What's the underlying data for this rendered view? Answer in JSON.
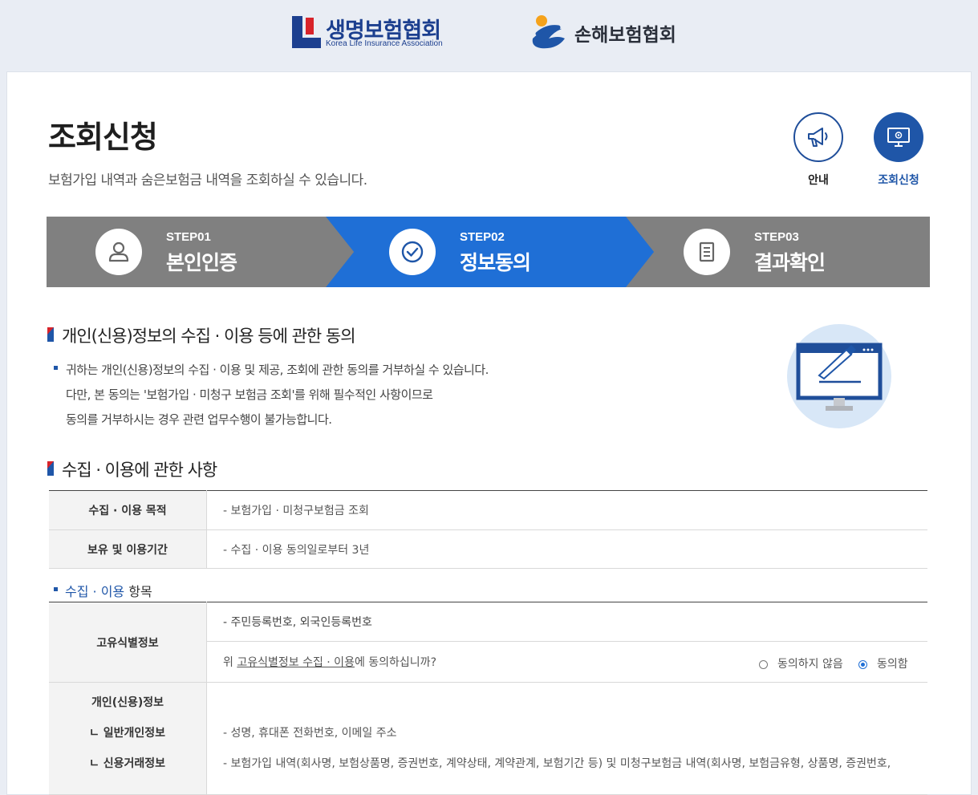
{
  "header": {
    "kli_name": "생명보험협회",
    "kli_eng": "Korea Life Insurance Association",
    "gi_name": "손해보험협회"
  },
  "page": {
    "title": "조회신청",
    "subtitle": "보험가입 내역과 숨은보험금 내역을 조회하실 수 있습니다."
  },
  "quick_buttons": {
    "guide_label": "안내",
    "inquiry_label": "조회신청"
  },
  "steps": [
    {
      "num": "STEP01",
      "name": "본인인증",
      "icon": "person-icon",
      "active": false
    },
    {
      "num": "STEP02",
      "name": "정보동의",
      "icon": "check-circle-icon",
      "active": true
    },
    {
      "num": "STEP03",
      "name": "결과확인",
      "icon": "document-icon",
      "active": false
    }
  ],
  "consent_section": {
    "title": "개인(신용)정보의 수집 · 이용 등에 관한 동의",
    "notes": [
      "귀하는 개인(신용)정보의 수집 · 이용 및 제공, 조회에 관한 동의를 거부하실 수 있습니다.",
      "다만, 본 동의는 '보험가입 · 미청구 보험금 조회'를 위해 필수적인 사항이므로",
      "동의를 거부하시는 경우 관련 업무수행이 불가능합니다."
    ]
  },
  "collection_section": {
    "title": "수집 · 이용에 관한 사항",
    "rows": [
      {
        "label": "수집 · 이용 목적",
        "value": "- 보험가입 · 미청구보험금 조회"
      },
      {
        "label": "보유 및 이용기간",
        "value": "- 수집 · 이용 동의일로부터 3년"
      }
    ],
    "items_head_blue": "수집 · 이용",
    "items_head_rest": " 항목",
    "unique_id": {
      "label": "고유식별정보",
      "value": "- 주민등록번호, 외국인등록번호",
      "question_pre": "위 ",
      "question_link": "고유식별정보 수집 · 이용",
      "question_post": "에 동의하십니까?",
      "disagree_label": "동의하지 않음",
      "agree_label": "동의함",
      "selected": "agree"
    },
    "personal_info": {
      "label": "개인(신용)정보",
      "general_label": "ㄴ 일반개인정보",
      "general_value": "- 성명, 휴대폰 전화번호, 이메일 주소",
      "credit_label": "ㄴ 신용거래정보",
      "credit_value": "- 보험가입 내역(회사명, 보험상품명, 증권번호, 계약상태, 계약관계, 보험기간 등) 및 미청구보험금 내역(회사명, 보험금유형, 상품명, 증권번호,"
    }
  },
  "colors": {
    "active_step": "#1f6fd6",
    "inactive_step": "#808080",
    "brand_blue": "#1f56a8",
    "flag_red": "#d8232a"
  }
}
